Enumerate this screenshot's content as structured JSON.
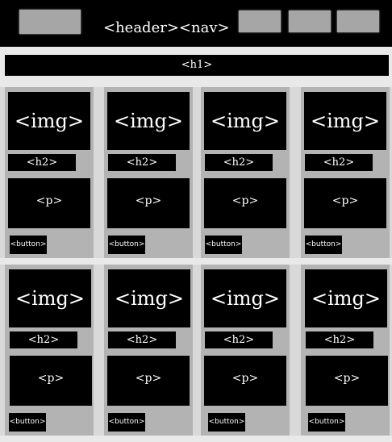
{
  "header": {
    "label": "<header><nav>",
    "nav_buttons": [
      "",
      "",
      ""
    ]
  },
  "h1": {
    "label": "<h1>"
  },
  "cards": [
    {
      "img": "<img>",
      "h2": "<h2>",
      "p": "<p>",
      "button": "<button>"
    },
    {
      "img": "<img>",
      "h2": "<h2>",
      "p": "<p>",
      "button": "<button>"
    },
    {
      "img": "<img>",
      "h2": "<h2>",
      "p": "<p>",
      "button": "<button>"
    },
    {
      "img": "<img>",
      "h2": "<h2>",
      "p": "<p>",
      "button": "<button>"
    },
    {
      "img": "<img>",
      "h2": "<h2>",
      "p": "<p>",
      "button": "<button>"
    },
    {
      "img": "<img>",
      "h2": "<h2>",
      "p": "<p>",
      "button": "<button>"
    },
    {
      "img": "<img>",
      "h2": "<h2>",
      "p": "<p>",
      "button": "<button>"
    },
    {
      "img": "<img>",
      "h2": "<h2>",
      "p": "<p>",
      "button": "<button>"
    }
  ]
}
